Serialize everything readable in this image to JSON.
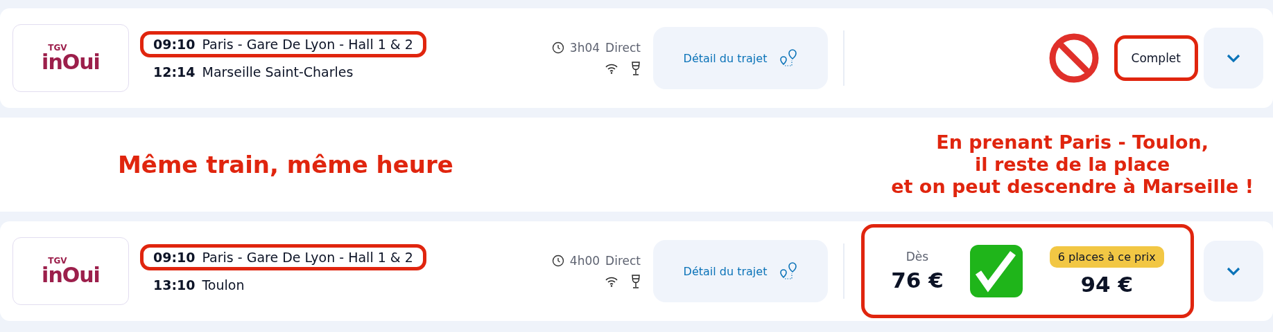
{
  "trips": [
    {
      "logo": {
        "top": "TGV",
        "name": "inOui"
      },
      "departure": {
        "time": "09:10",
        "station": "Paris - Gare De Lyon - Hall 1 & 2",
        "highlighted": true
      },
      "arrival": {
        "time": "12:14",
        "station": "Marseille Saint-Charles",
        "highlighted": false
      },
      "duration": "3h04",
      "connection": "Direct",
      "detail_button": "Détail du trajet",
      "status": {
        "kind": "full",
        "label": "Complet",
        "highlighted": true
      }
    },
    {
      "logo": {
        "top": "TGV",
        "name": "inOui"
      },
      "departure": {
        "time": "09:10",
        "station": "Paris - Gare De Lyon - Hall 1 & 2",
        "highlighted": true
      },
      "arrival": {
        "time": "13:10",
        "station": "Toulon",
        "highlighted": false
      },
      "duration": "4h00",
      "connection": "Direct",
      "detail_button": "Détail du trajet",
      "status": {
        "kind": "price",
        "from_label": "Dès",
        "from_price": "76 €",
        "badge": "6 places à ce prix",
        "price": "94 €",
        "highlighted": true
      }
    }
  ],
  "annotations": {
    "left": "Même train, même heure",
    "right": [
      "En prenant Paris - Toulon,",
      "il reste de la place",
      "et on peut descendre à Marseille !"
    ]
  }
}
